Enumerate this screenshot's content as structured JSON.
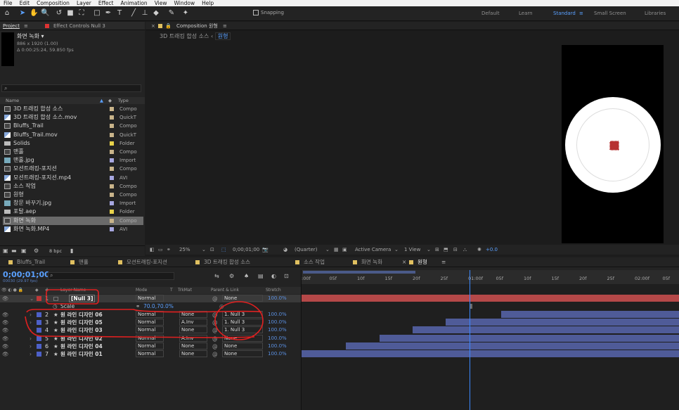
{
  "menu": [
    "File",
    "Edit",
    "Composition",
    "Layer",
    "Effect",
    "Animation",
    "View",
    "Window",
    "Help"
  ],
  "toolbar": {
    "snapping": "Snapping",
    "workspaces": [
      "Default",
      "Learn",
      "Standard",
      "Small Screen",
      "Libraries"
    ],
    "active_ws": "Standard"
  },
  "project": {
    "tab": "Project",
    "tab2": "Effect Controls Null 3",
    "comp_name": "화면 녹화 ▾",
    "comp_info1": "886 x 1920 (1.00)",
    "comp_info2": "Δ 0:00:25:24, 59.850 fps",
    "col_name": "Name",
    "col_type": "Type",
    "items": [
      {
        "name": "3D 트래킹 합성 소스",
        "type": "Compo",
        "icon": "comp",
        "color": "#c9b48a"
      },
      {
        "name": "3D 트래킹 합성 소스.mov",
        "type": "QuickT",
        "icon": "video",
        "color": "#c9b48a"
      },
      {
        "name": "Bluffs_Trail",
        "type": "Compo",
        "icon": "comp",
        "color": "#c9b48a"
      },
      {
        "name": "Bluffs_Trail.mov",
        "type": "QuickT",
        "icon": "video",
        "color": "#c9b48a"
      },
      {
        "name": "Solids",
        "type": "Folder",
        "icon": "folder",
        "color": "#e8d24a"
      },
      {
        "name": "맨홀",
        "type": "Compo",
        "icon": "comp",
        "color": "#c9b48a"
      },
      {
        "name": "맨홀.jpg",
        "type": "Import",
        "icon": "image",
        "color": "#a7a7e0"
      },
      {
        "name": "모션트래킹-포지션",
        "type": "Compo",
        "icon": "comp",
        "color": "#c9b48a"
      },
      {
        "name": "모션트래킹-포지션.mp4",
        "type": "AVI",
        "icon": "video",
        "color": "#a7a7e0"
      },
      {
        "name": "소스 작업",
        "type": "Compo",
        "icon": "comp",
        "color": "#c9b48a"
      },
      {
        "name": "원형",
        "type": "Compo",
        "icon": "comp",
        "color": "#c9b48a"
      },
      {
        "name": "창문 바꾸기.jpg",
        "type": "Import",
        "icon": "image",
        "color": "#a7a7e0"
      },
      {
        "name": "포탈.aep",
        "type": "Folder",
        "icon": "folder",
        "color": "#e8d24a"
      },
      {
        "name": "화면 녹화",
        "type": "Compo",
        "icon": "comp",
        "color": "#c9b48a",
        "selected": true
      },
      {
        "name": "화면 녹화.MP4",
        "type": "AVI",
        "icon": "video",
        "color": "#a7a7e0"
      }
    ],
    "bpc": "8 bpc"
  },
  "comp": {
    "tab": "Composition 원형",
    "breadcrumb1": "3D 트래킹 합성 소스",
    "breadcrumb2": "원형",
    "zoom": "25%",
    "time": "0;00;01;00",
    "quality": "(Quarter)",
    "camera": "Active Camera",
    "view": "1 View",
    "exposure": "+0.0"
  },
  "timeline": {
    "tabs": [
      "Bluffs_Trail",
      "맨홀",
      "모션트래킹-포지션",
      "3D 트래킹 합성 소스",
      "소스 작업",
      "화면 녹화",
      "원형"
    ],
    "active_tab": "원형",
    "timecode": "0;00;01;00",
    "fps": "00030 (29.97 fps)",
    "cols": {
      "layer": "Layer Name",
      "mode": "Mode",
      "t": "T",
      "trkmat": "TrkMat",
      "parent": "Parent & Link",
      "stretch": "Stretch"
    },
    "ruler": [
      ":00f",
      "05f",
      "10f",
      "15f",
      "20f",
      "25f",
      "01:00f",
      "05f",
      "10f",
      "15f",
      "20f",
      "25f",
      "02:00f",
      "05f"
    ],
    "scale": {
      "label": "Scale",
      "value": "70.0,70.0%"
    },
    "layers": [
      {
        "num": "1",
        "name": "[Null 3]",
        "mode": "Normal",
        "trkmat": "",
        "parent": "None",
        "stretch": "100.0%",
        "color": "#c03838",
        "null": true
      },
      {
        "num": "2",
        "name": "원 라인 디자인 06",
        "mode": "Normal",
        "trkmat": "None",
        "parent": "1. Null 3",
        "stretch": "100.0%"
      },
      {
        "num": "3",
        "name": "원 라인 디자인 05",
        "mode": "Normal",
        "trkmat": "A.Inv",
        "parent": "1. Null 3",
        "stretch": "100.0%"
      },
      {
        "num": "4",
        "name": "원 라인 디자인 03",
        "mode": "Normal",
        "trkmat": "None",
        "parent": "1. Null 3",
        "stretch": "100.0%"
      },
      {
        "num": "5",
        "name": "원 라인 디자인 02",
        "mode": "Normal",
        "trkmat": "A.Inv",
        "parent": "None",
        "stretch": "100.0%"
      },
      {
        "num": "6",
        "name": "원 라인 디자인 04",
        "mode": "Normal",
        "trkmat": "None",
        "parent": "None",
        "stretch": "100.0%"
      },
      {
        "num": "7",
        "name": "원 라인 디자인 01",
        "mode": "Normal",
        "trkmat": "None",
        "parent": "None",
        "stretch": "100.0%"
      }
    ],
    "bar_starts_frames": [
      0,
      36,
      26,
      20,
      14,
      8,
      0
    ]
  }
}
